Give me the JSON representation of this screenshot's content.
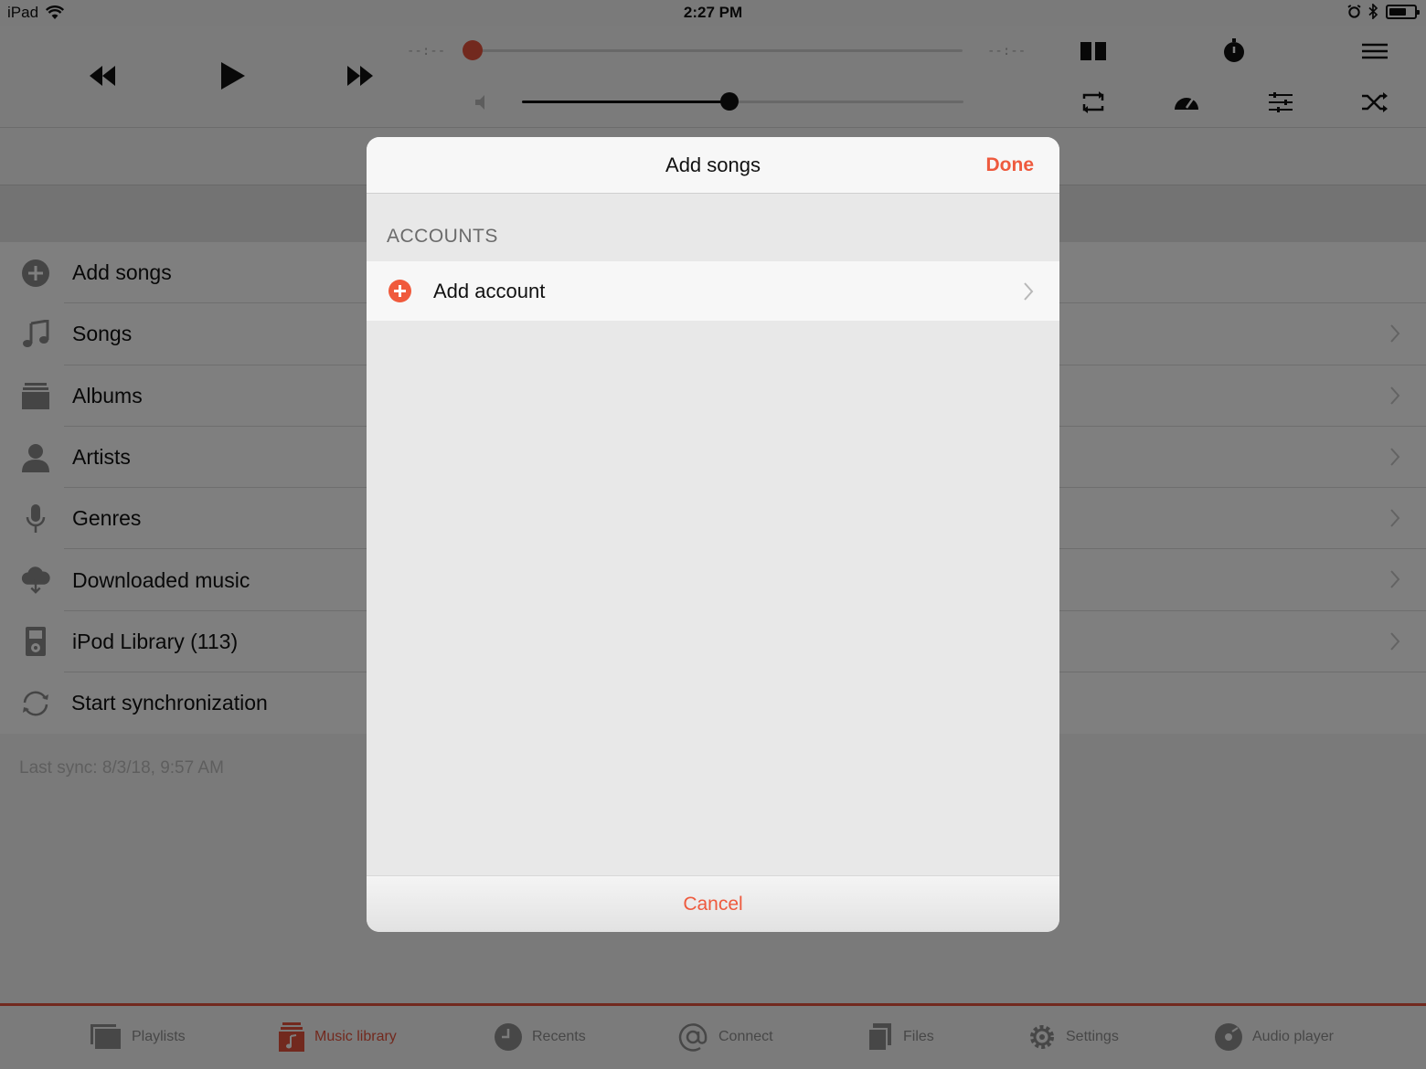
{
  "status_bar": {
    "device": "iPad",
    "time": "2:27 PM",
    "battery_level": 0.7
  },
  "player": {
    "elapsed": "--:--",
    "remaining": "--:--",
    "progress": 0.0,
    "volume": 0.47,
    "accent_color": "#e5533d",
    "left_controls": [
      "rewind-icon",
      "play-icon",
      "fast-forward-icon"
    ],
    "tools_row1": [
      "split-view-icon",
      "sleep-timer-icon",
      "menu-icon"
    ],
    "tools_row2": [
      "repeat-icon",
      "speed-icon",
      "equalizer-icon",
      "shuffle-icon"
    ]
  },
  "library": {
    "items": [
      {
        "label": "Add songs",
        "icon": "add-circle-icon",
        "chevron": false
      },
      {
        "label": "Songs",
        "icon": "music-note-icon",
        "chevron": true
      },
      {
        "label": "Albums",
        "icon": "albums-icon",
        "chevron": true
      },
      {
        "label": "Artists",
        "icon": "artist-icon",
        "chevron": true
      },
      {
        "label": "Genres",
        "icon": "microphone-icon",
        "chevron": true
      },
      {
        "label": "Downloaded music",
        "icon": "cloud-download-icon",
        "chevron": true
      },
      {
        "label": "iPod Library (113)",
        "icon": "ipod-icon",
        "chevron": true
      },
      {
        "label": "Start synchronization",
        "icon": "sync-icon",
        "chevron": false
      }
    ],
    "last_sync": "Last sync: 8/3/18, 9:57 AM"
  },
  "tabs": [
    {
      "label": "Playlists",
      "icon": "playlists-icon",
      "active": false
    },
    {
      "label": "Music library",
      "icon": "music-library-icon",
      "active": true
    },
    {
      "label": "Recents",
      "icon": "clock-icon",
      "active": false
    },
    {
      "label": "Connect",
      "icon": "at-icon",
      "active": false
    },
    {
      "label": "Files",
      "icon": "files-icon",
      "active": false
    },
    {
      "label": "Settings",
      "icon": "gear-icon",
      "active": false
    },
    {
      "label": "Audio player",
      "icon": "disc-icon",
      "active": false
    }
  ],
  "modal": {
    "title": "Add songs",
    "done_label": "Done",
    "section_header": "ACCOUNTS",
    "row_label": "Add account",
    "cancel_label": "Cancel",
    "accent_color": "#ee5a3e"
  }
}
